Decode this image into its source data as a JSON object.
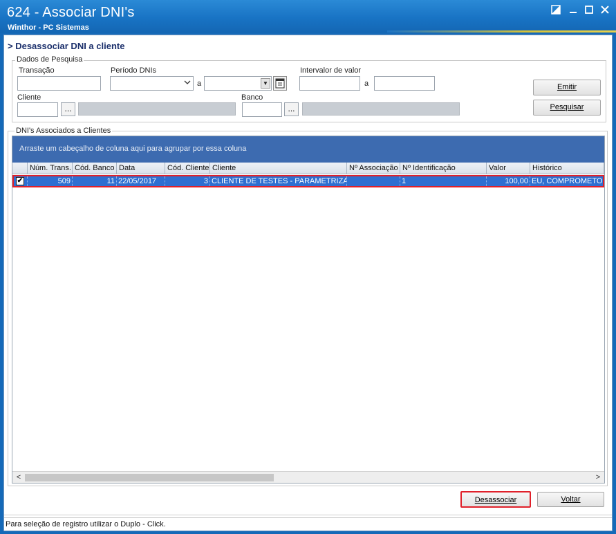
{
  "window": {
    "title": "624 - Associar DNI's",
    "subtitle": "Winthor - PC Sistemas",
    "controls": [
      "restore-icon",
      "minimize-icon",
      "maximize-icon",
      "close-icon"
    ]
  },
  "section_title": "> Desassociar DNI a cliente",
  "search": {
    "group_label": "Dados de Pesquisa",
    "transacao_label": "Transação",
    "transacao_value": "",
    "periodo_label": "Período DNIs",
    "periodo_sep": "a",
    "periodo_from": "",
    "periodo_to": "",
    "intervalo_label": "Intervalor de valor",
    "intervalo_sep": "a",
    "intervalo_from": "",
    "intervalo_to": "",
    "cliente_label": "Cliente",
    "cliente_code": "",
    "cliente_name": "",
    "banco_label": "Banco",
    "banco_code": "",
    "banco_name": "",
    "dots": "...",
    "emitir_label": "Emitir",
    "pesquisar_label": "Pesquisar"
  },
  "grid": {
    "group_label": "DNI's Associados a Clientes",
    "group_panel_text": "Arraste um cabeçalho de coluna aqui para agrupar por essa coluna",
    "columns": [
      "Núm. Trans.",
      "Cód. Banco",
      "Data",
      "Cód. Cliente",
      "Cliente",
      "Nº Associação",
      "Nº Identificação",
      "Valor",
      "Histórico"
    ],
    "rows": [
      {
        "checked": true,
        "check_mark": "✔",
        "num_trans": "509",
        "cod_banco": "11",
        "data": "22/05/2017",
        "cod_cliente": "3",
        "cliente": "CLIENTE DE TESTES - PARAMETRIZACAO",
        "n_associacao": "",
        "n_identificacao": "1",
        "valor": "100,00",
        "historico": "EU, COMPROMETO A"
      }
    ],
    "scroll_left": "<",
    "scroll_right": ">"
  },
  "footer": {
    "desassociar_label": "Desassociar",
    "voltar_label": "Voltar"
  },
  "status_text": "Para seleção de registro utilizar o Duplo - Click.",
  "colors": {
    "titlebar": "#1873c4",
    "group_panel": "#3d6bb0",
    "selected_row": "#2e6fd1",
    "highlight": "#e0202a"
  }
}
